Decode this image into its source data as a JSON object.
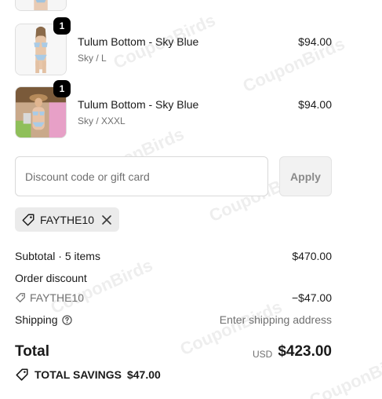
{
  "items": [
    {
      "name": "Tulum Bottom - Sky Blue",
      "variant": "Sky / L",
      "price": "$94.00",
      "quantity": "1"
    },
    {
      "name": "Tulum Bottom - Sky Blue",
      "variant": "Sky / XXXL",
      "price": "$94.00",
      "quantity": "1"
    }
  ],
  "discount": {
    "placeholder": "Discount code or gift card",
    "apply_label": "Apply",
    "applied_code": "FAYTHE10"
  },
  "summary": {
    "subtotal_label": "Subtotal · 5 items",
    "subtotal_value": "$470.00",
    "order_discount_label": "Order discount",
    "discount_code": "FAYTHE10",
    "discount_value": "−$47.00",
    "shipping_label": "Shipping",
    "shipping_value": "Enter shipping address",
    "total_label": "Total",
    "currency": "USD",
    "total_value": "$423.00",
    "savings_label": "TOTAL SAVINGS",
    "savings_value": "$47.00"
  },
  "watermark": "CouponBirds",
  "icons": {
    "tag": "tag-icon",
    "close": "close-icon",
    "help": "question-circle-icon"
  }
}
